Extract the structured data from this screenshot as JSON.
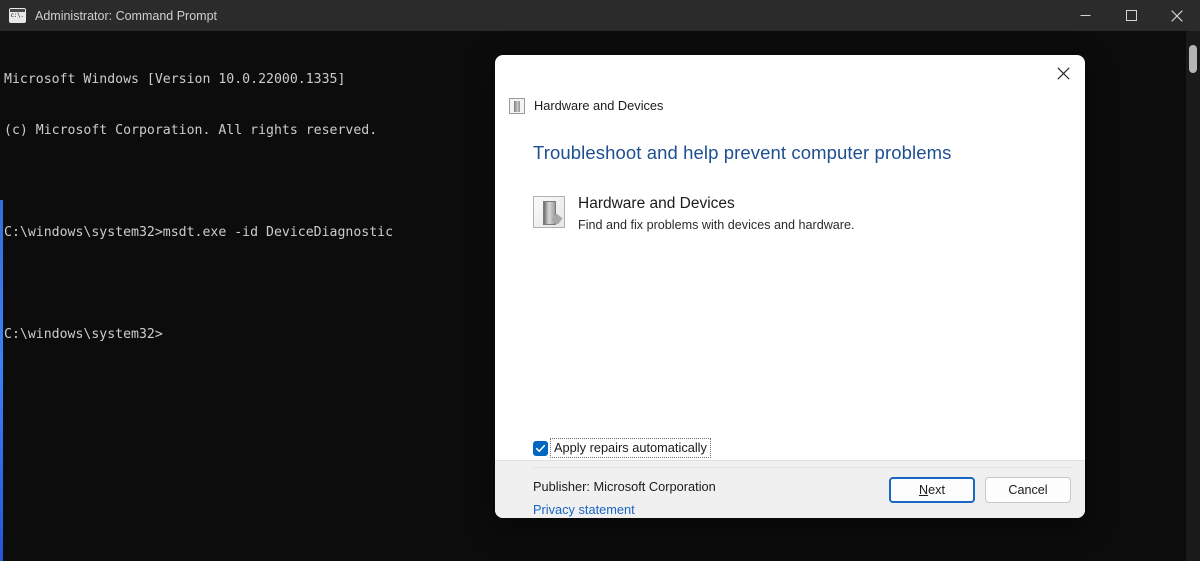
{
  "console_window": {
    "titlebar": {
      "icon": "console-icon",
      "title": "Administrator: Command Prompt",
      "minimize_label": "Minimize",
      "maximize_label": "Maximize",
      "close_label": "Close"
    },
    "lines": [
      "Microsoft Windows [Version 10.0.22000.1335]",
      "(c) Microsoft Corporation. All rights reserved.",
      "",
      "C:\\windows\\system32>msdt.exe -id DeviceDiagnostic",
      "",
      "C:\\windows\\system32>"
    ],
    "colors": {
      "titlebar_bg": "#2b2b2b",
      "body_bg": "#0c0c0c",
      "text": "#cccccc",
      "accent_stripe": "#3b82f6"
    }
  },
  "dialog": {
    "header": {
      "icon": "device-icon",
      "title": "Hardware and Devices"
    },
    "close_icon": "close-icon",
    "heading": "Troubleshoot and help prevent computer problems",
    "troubleshooter": {
      "icon": "device-icon",
      "title": "Hardware and Devices",
      "description": "Find and fix problems with devices and hardware."
    },
    "checkbox": {
      "label": "Apply repairs automatically",
      "checked": true,
      "focused": true
    },
    "publisher": "Publisher:  Microsoft Corporation",
    "privacy_link": "Privacy statement",
    "footer": {
      "next_label": "Next",
      "next_accel": "N",
      "next_rest": "ext",
      "cancel_label": "Cancel"
    },
    "colors": {
      "heading": "#1d4f91",
      "link": "#1a66c4",
      "checkbox_fill": "#0067c0",
      "footer_bg": "#f0f0f0"
    }
  }
}
